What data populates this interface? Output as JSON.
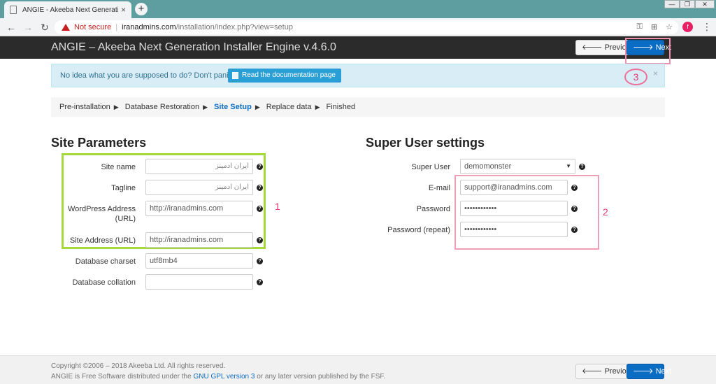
{
  "browser": {
    "tab_title": "ANGIE - Akeeba Next Generation",
    "tab_close": "×",
    "new_tab": "+",
    "security_text": "Not secure",
    "url_host": "iranadmins.com",
    "url_path": "/installation/index.php?view=setup",
    "profile_initial": "f",
    "window_controls": [
      "—",
      "❐",
      "✕"
    ]
  },
  "header": {
    "title": "ANGIE – Akeeba Next Generation Installer Engine v.4.6.0",
    "previous_label": "Previous",
    "next_label": "Next"
  },
  "alert": {
    "text": "No idea what you are supposed to do? Don't panic!",
    "doc_button_label": "Read the documentation page",
    "close": "×"
  },
  "breadcrumb": {
    "steps": [
      "Pre-installation",
      "Database Restoration",
      "Site Setup",
      "Replace data",
      "Finished"
    ],
    "active_index": 2
  },
  "site_params": {
    "heading": "Site Parameters",
    "site_name_label": "Site name",
    "site_name_value": "ایران ادمینز",
    "tagline_label": "Tagline",
    "tagline_value": "ایران ادمینز",
    "wp_address_label_1": "WordPress Address",
    "wp_address_label_2": "(URL)",
    "wp_address_value": "http://iranadmins.com",
    "site_address_label": "Site Address (URL)",
    "site_address_value": "http://iranadmins.com",
    "db_charset_label": "Database charset",
    "db_charset_value": "utf8mb4",
    "db_collation_label": "Database collation",
    "db_collation_value": ""
  },
  "super_user": {
    "heading": "Super User settings",
    "super_user_label": "Super User",
    "super_user_value": "demomonster",
    "email_label": "E-mail",
    "email_value": "support@iranadmins.com",
    "password_label": "Password",
    "password_value": "••••••••••••",
    "password_repeat_label": "Password (repeat)",
    "password_repeat_value": "••••••••••••"
  },
  "annotations": {
    "one": "1",
    "two": "2",
    "three": "3"
  },
  "help_glyph": "?",
  "footer": {
    "copyright": "Copyright ©2006 – 2018 Akeeba Ltd. All rights reserved.",
    "license_prefix": "ANGIE is Free Software distributed under the",
    "license_link": "GNU GPL version 3",
    "license_suffix": "or any later version published by the FSF.",
    "previous_label": "Previous",
    "next_label": "Next"
  },
  "colors": {
    "primary": "#0b6cc4",
    "header_bg": "#2b2b2b",
    "annotation_pink": "#e23a70",
    "annotation_green": "#a5d83c"
  }
}
